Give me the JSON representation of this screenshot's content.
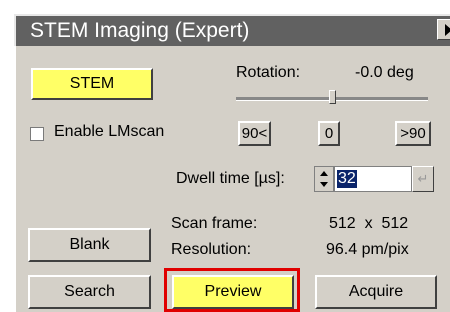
{
  "window": {
    "title": "STEM Imaging (Expert)"
  },
  "buttons": {
    "stem": "STEM",
    "shift_left": "90<",
    "zero": "0",
    "shift_right": ">90",
    "blank": "Blank",
    "search": "Search",
    "preview": "Preview",
    "acquire": "Acquire"
  },
  "rotation": {
    "label": "Rotation:",
    "value": "-0.0 deg",
    "slider_fraction": 0.5
  },
  "lmscan": {
    "label": "Enable LMscan",
    "checked": false
  },
  "dwell": {
    "label": "Dwell time [µs]:",
    "value": "32",
    "enter_symbol": "↵"
  },
  "scan": {
    "frame_label": "Scan frame:",
    "frame_value": "512  x  512",
    "resolution_label": "Resolution:",
    "resolution_value": "96.4 pm/pix"
  },
  "colors": {
    "active_button": "#ffff66",
    "highlight": "#e00000",
    "title_bar": "#616161"
  }
}
